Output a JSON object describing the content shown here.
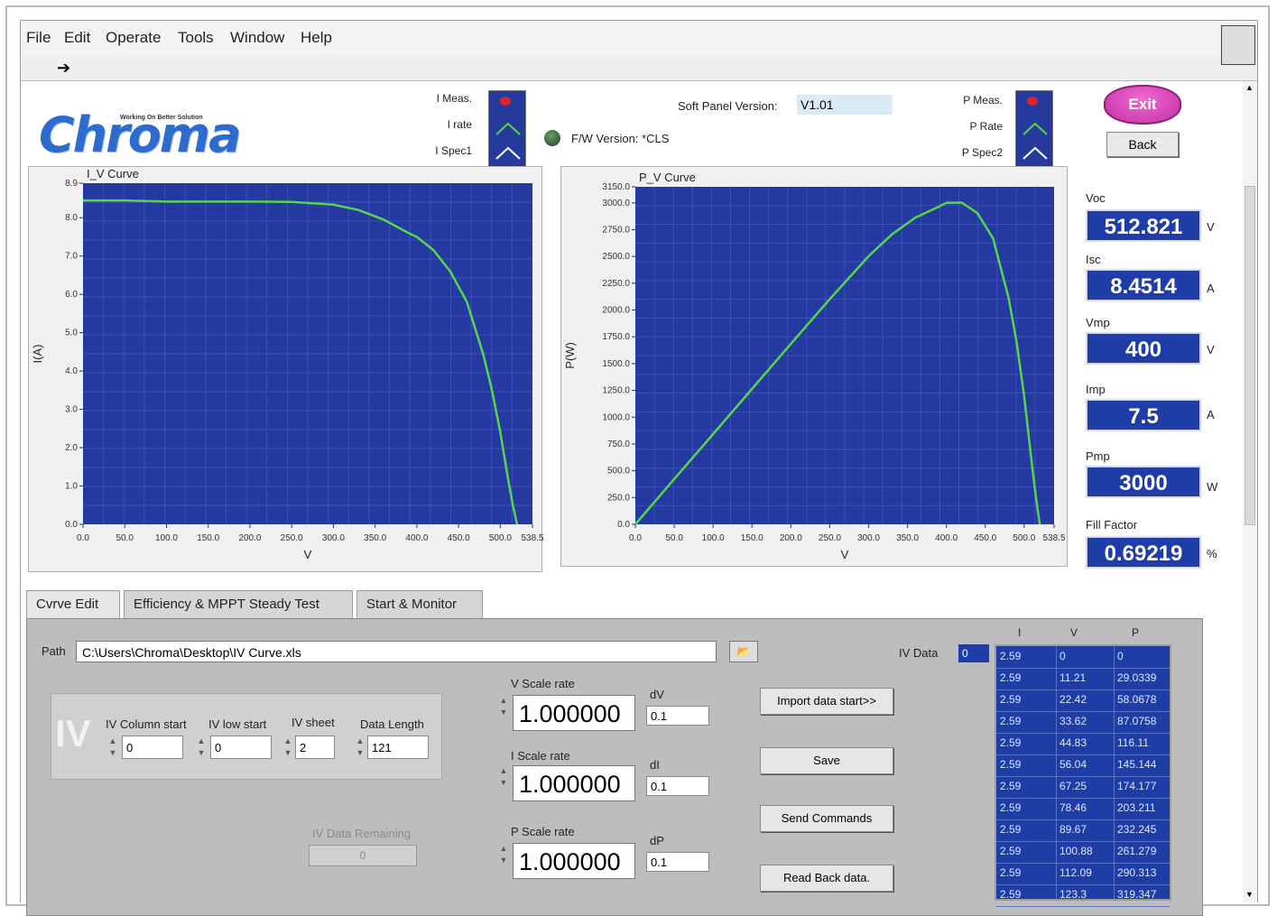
{
  "menu": [
    "File",
    "Edit",
    "Operate",
    "Tools",
    "Window",
    "Help"
  ],
  "logo": {
    "text": "Chroma",
    "tagline": "Working On Better Solution"
  },
  "soft_panel": {
    "label": "Soft Panel Version:",
    "value": "V1.01"
  },
  "fw": {
    "label": "F/W Version: *CLS"
  },
  "iv_legend": [
    "I Meas.",
    "I rate",
    "I Spec1"
  ],
  "pv_legend": [
    "P Meas.",
    "P Rate",
    "P Spec2"
  ],
  "buttons": {
    "exit": "Exit",
    "back": "Back"
  },
  "readouts": [
    {
      "label": "Voc",
      "value": "512.821",
      "unit": "V"
    },
    {
      "label": "Isc",
      "value": "8.4514",
      "unit": "A"
    },
    {
      "label": "Vmp",
      "value": "400",
      "unit": "V"
    },
    {
      "label": "Imp",
      "value": "7.5",
      "unit": "A"
    },
    {
      "label": "Pmp",
      "value": "3000",
      "unit": "W"
    },
    {
      "label": "Fill Factor",
      "value": "0.69219",
      "unit": "%"
    }
  ],
  "chart_data": [
    {
      "type": "line",
      "title": "I_V Curve",
      "xlabel": "V",
      "ylabel": "I(A)",
      "xlim": [
        0,
        538.5
      ],
      "ylim": [
        0,
        8.9
      ],
      "x_ticks": [
        "0.0",
        "50.0",
        "100.0",
        "150.0",
        "200.0",
        "250.0",
        "300.0",
        "350.0",
        "400.0",
        "450.0",
        "500.0",
        "538.5"
      ],
      "y_ticks": [
        "0.0",
        "1.0",
        "2.0",
        "3.0",
        "4.0",
        "5.0",
        "6.0",
        "7.0",
        "8.0",
        "8.9"
      ],
      "series": [
        {
          "x": [
            0,
            50,
            100,
            150,
            200,
            250,
            300,
            330,
            360,
            390,
            400,
            420,
            440,
            460,
            480,
            490,
            500,
            510,
            515,
            520
          ],
          "y": [
            8.45,
            8.45,
            8.42,
            8.42,
            8.42,
            8.41,
            8.34,
            8.2,
            7.95,
            7.6,
            7.5,
            7.15,
            6.6,
            5.8,
            4.4,
            3.5,
            2.4,
            1.1,
            0.5,
            0.0
          ]
        }
      ]
    },
    {
      "type": "line",
      "title": "P_V Curve",
      "xlabel": "V",
      "ylabel": "P(W)",
      "xlim": [
        0,
        538.5
      ],
      "ylim": [
        0,
        3150
      ],
      "x_ticks": [
        "0.0",
        "50.0",
        "100.0",
        "150.0",
        "200.0",
        "250.0",
        "300.0",
        "350.0",
        "400.0",
        "450.0",
        "500.0",
        "538.5"
      ],
      "y_ticks": [
        "0.0",
        "250.0",
        "500.0",
        "750.0",
        "1000.0",
        "1250.0",
        "1500.0",
        "1750.0",
        "2000.0",
        "2250.0",
        "2500.0",
        "2750.0",
        "3000.0",
        "3150.0"
      ],
      "series": [
        {
          "x": [
            0,
            50,
            100,
            150,
            200,
            250,
            300,
            330,
            360,
            390,
            400,
            420,
            440,
            460,
            480,
            490,
            500,
            510,
            515,
            520
          ],
          "y": [
            0,
            423,
            842,
            1263,
            1684,
            2102,
            2502,
            2706,
            2862,
            2964,
            3000,
            3003,
            2904,
            2668,
            2112,
            1715,
            1200,
            561,
            258,
            0
          ]
        }
      ]
    }
  ],
  "tabs": [
    "Cvrve Edit",
    "Efficiency & MPPT Steady Test",
    "Start & Monitor"
  ],
  "curve_edit": {
    "path_label": "Path",
    "path_value": "C:\\Users\\Chroma\\Desktop\\IV Curve.xls",
    "iv_title": "IV",
    "fields": [
      {
        "label": "IV Column start",
        "value": "0"
      },
      {
        "label": "IV low start",
        "value": "0"
      },
      {
        "label": "IV sheet",
        "value": "2"
      },
      {
        "label": "Data Length",
        "value": "121"
      }
    ],
    "remaining_label": "IV Data Remaining",
    "remaining_value": "0",
    "scales": [
      {
        "label": "V Scale rate",
        "value": "1.000000",
        "d_label": "dV",
        "d_value": "0.1"
      },
      {
        "label": "I Scale rate",
        "value": "1.000000",
        "d_label": "dI",
        "d_value": "0.1"
      },
      {
        "label": "P Scale rate",
        "value": "1.000000",
        "d_label": "dP",
        "d_value": "0.1"
      }
    ],
    "actions": [
      "Import data start>>",
      "Save",
      "Send Commands",
      "Read Back data."
    ],
    "iv_data_label": "IV Data",
    "iv_data_index": "0",
    "table_headers": [
      "I",
      "V",
      "P"
    ],
    "table_rows": [
      [
        "2.59",
        "0",
        "0"
      ],
      [
        "2.59",
        "11.21",
        "29.0339"
      ],
      [
        "2.59",
        "22.42",
        "58.0678"
      ],
      [
        "2.59",
        "33.62",
        "87.0758"
      ],
      [
        "2.59",
        "44.83",
        "116.11"
      ],
      [
        "2.59",
        "56.04",
        "145.144"
      ],
      [
        "2.59",
        "67.25",
        "174.177"
      ],
      [
        "2.59",
        "78.46",
        "203.211"
      ],
      [
        "2.59",
        "89.67",
        "232.245"
      ],
      [
        "2.59",
        "100.88",
        "261.279"
      ],
      [
        "2.59",
        "112.09",
        "290.313"
      ],
      [
        "2.59",
        "123.3",
        "319.347"
      ]
    ]
  },
  "colors": {
    "plot_bg": "#243aa0",
    "grid": "#3a52b4",
    "curve": "#56d64a",
    "indicator_bg": "#1f3da6"
  }
}
